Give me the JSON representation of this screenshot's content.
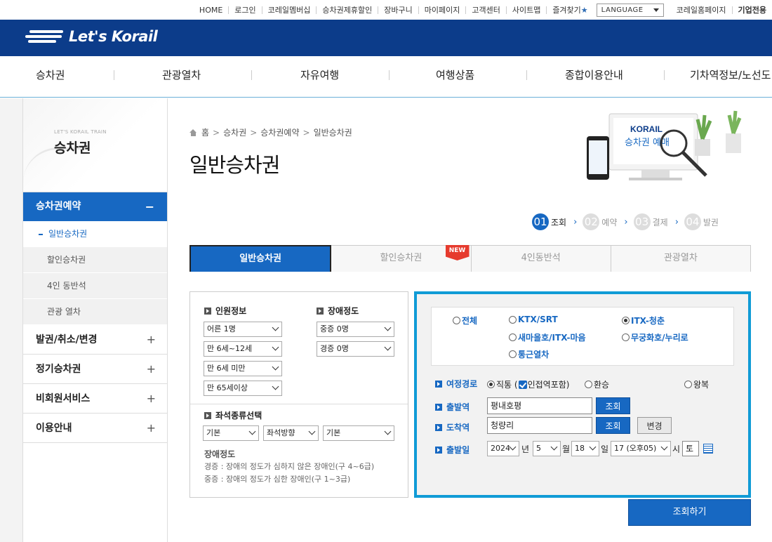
{
  "util": {
    "links": [
      "HOME",
      "로그인",
      "코레일멤버십",
      "승차권제휴할인",
      "장바구니",
      "마이페이지",
      "고객센터",
      "사이트맵",
      "즐겨찾기"
    ],
    "language": "LANGUAGE",
    "homepage": "코레일홈페이지",
    "biz": "기업전용"
  },
  "brand": {
    "logo_text": "Let's Korail"
  },
  "gnb": [
    "승차권",
    "관광열차",
    "자유여행",
    "여행상품",
    "종합이용안내",
    "기차역정보/노선도"
  ],
  "lnb": {
    "sub": "LET'S KORAIL TRAIN",
    "title": "승차권",
    "active": "승차권예약",
    "subitems": [
      "일반승차권",
      "할인승차권",
      "4인 동반석",
      "관광 열차"
    ],
    "mains": [
      "발권/취소/변경",
      "정기승차권",
      "비회원서비스",
      "이용안내"
    ]
  },
  "breadcrumb": [
    "홈",
    "승차권",
    "승차권예약",
    "일반승차권"
  ],
  "page_title": "일반승차권",
  "illustration": {
    "brand": "KORAIL",
    "caption": "승차권 예매"
  },
  "steps": [
    {
      "num": "01",
      "label": "조회",
      "active": true
    },
    {
      "num": "02",
      "label": "예약",
      "active": false
    },
    {
      "num": "03",
      "label": "결제",
      "active": false
    },
    {
      "num": "04",
      "label": "발권",
      "active": false
    }
  ],
  "tabs": [
    "일반승차권",
    "할인승차권",
    "4인동반석",
    "관광열차"
  ],
  "new_badge": "NEW",
  "passenger": {
    "title": "인원정보",
    "selects": [
      "어른 1명",
      "만 6세~12세",
      "만 6세 미만",
      "만 65세이상"
    ]
  },
  "disability": {
    "title": "장애정도",
    "selects": [
      "중증 0명",
      "경증 0명"
    ]
  },
  "seat": {
    "title": "좌석종류선택",
    "selects": [
      "기본",
      "좌석방향",
      "기본"
    ]
  },
  "disability_note": {
    "heading": "장애정도",
    "lines": [
      "경증 : 장애의 정도가 심하지 않은 장애인(구 4~6급)",
      "중증 : 장애의 정도가 심한 장애인(구 1~3급)"
    ]
  },
  "train_types": [
    {
      "label": "전체",
      "checked": false
    },
    {
      "label": "KTX/SRT",
      "checked": false
    },
    {
      "label": "ITX-청춘",
      "checked": true
    },
    {
      "label": "새마을호/ITX-마음",
      "checked": false
    },
    {
      "label": "무궁화호/누리로",
      "checked": false
    },
    {
      "label": "통근열차",
      "checked": false
    }
  ],
  "route": {
    "label": "여정경로",
    "direct": "직통",
    "include_adjacent": "인접역포함",
    "transfer": "환승",
    "roundtrip": "왕복"
  },
  "departure": {
    "label": "출발역",
    "value": "평내호평",
    "button": "조회"
  },
  "arrival": {
    "label": "도착역",
    "value": "청량리",
    "button": "조회",
    "swap": "변경"
  },
  "date": {
    "label": "출발일",
    "year": "2024",
    "year_unit": "년",
    "month": "5",
    "month_unit": "월",
    "day": "18",
    "day_unit": "일",
    "hour": "17 (오후05)",
    "hour_unit": "시",
    "weekday": "토"
  },
  "search_button": "조회하기",
  "colors": {
    "brand": "#0c3c8a",
    "accent": "#1768c2",
    "panel_border": "#109bd6",
    "new": "#e63b2e"
  }
}
